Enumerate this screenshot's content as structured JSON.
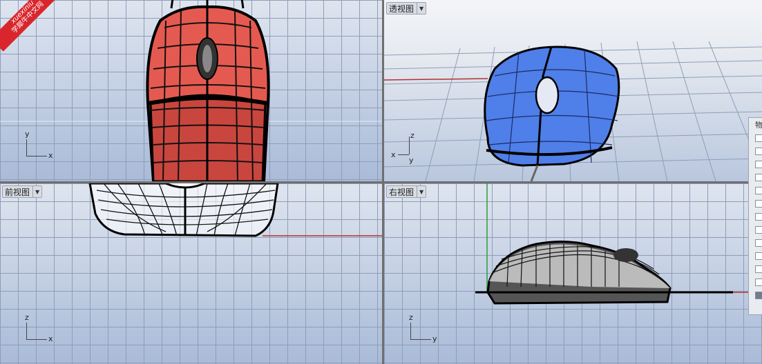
{
  "viewports": {
    "top": {
      "title": "",
      "axis_v": "y",
      "axis_h": "x"
    },
    "perspective": {
      "title": "透视图",
      "axis_v": "z",
      "axis_h": "x",
      "axis_d": "y"
    },
    "front": {
      "title": "前视图",
      "axis_v": "z",
      "axis_h": "x"
    },
    "right": {
      "title": "右视图",
      "axis_v": "z",
      "axis_h": "y"
    }
  },
  "side_panel": {
    "title": "物"
  },
  "watermark": {
    "line1": "xuexiniu",
    "line2": "学犀牛中文网"
  },
  "colors": {
    "mouse_red": "#e0453e",
    "mouse_blue": "#4f7fe8",
    "grid": "#8e9db8",
    "x_axis": "#b03030",
    "z_axis": "#2f9b3b"
  }
}
